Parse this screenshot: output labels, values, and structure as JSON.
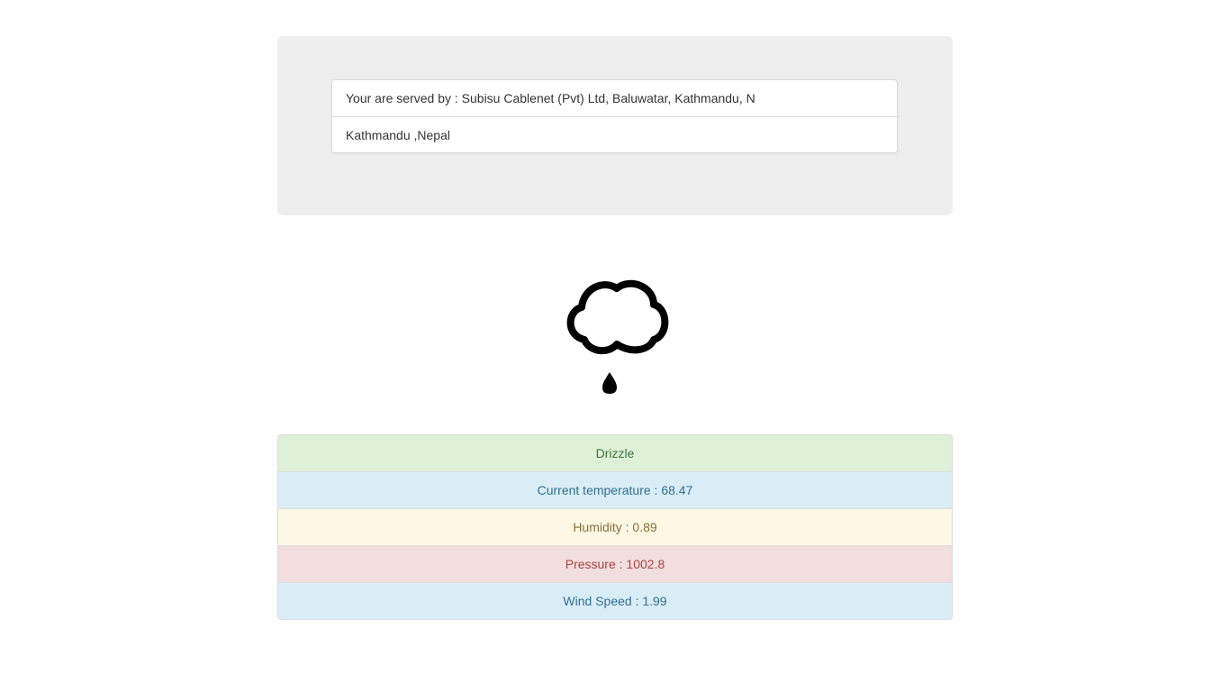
{
  "location_panel": {
    "provider_text": "Your are served by : Subisu Cablenet (Pvt) Ltd, Baluwatar, Kathmandu, N",
    "location_text": "Kathmandu ,Nepal"
  },
  "weather_icon": "cloud-drizzle-icon",
  "weather": {
    "summary": "Drizzle",
    "temperature": "Current temperature : 68.47",
    "humidity": "Humidity : 0.89",
    "pressure": "Pressure : 1002.8",
    "wind_speed": "Wind Speed : 1.99"
  },
  "colors": {
    "success_bg": "#dff0d8",
    "info_bg": "#d9edf7",
    "warning_bg": "#fcf8e3",
    "danger_bg": "#f2dede",
    "panel_bg": "#eeeeee"
  }
}
